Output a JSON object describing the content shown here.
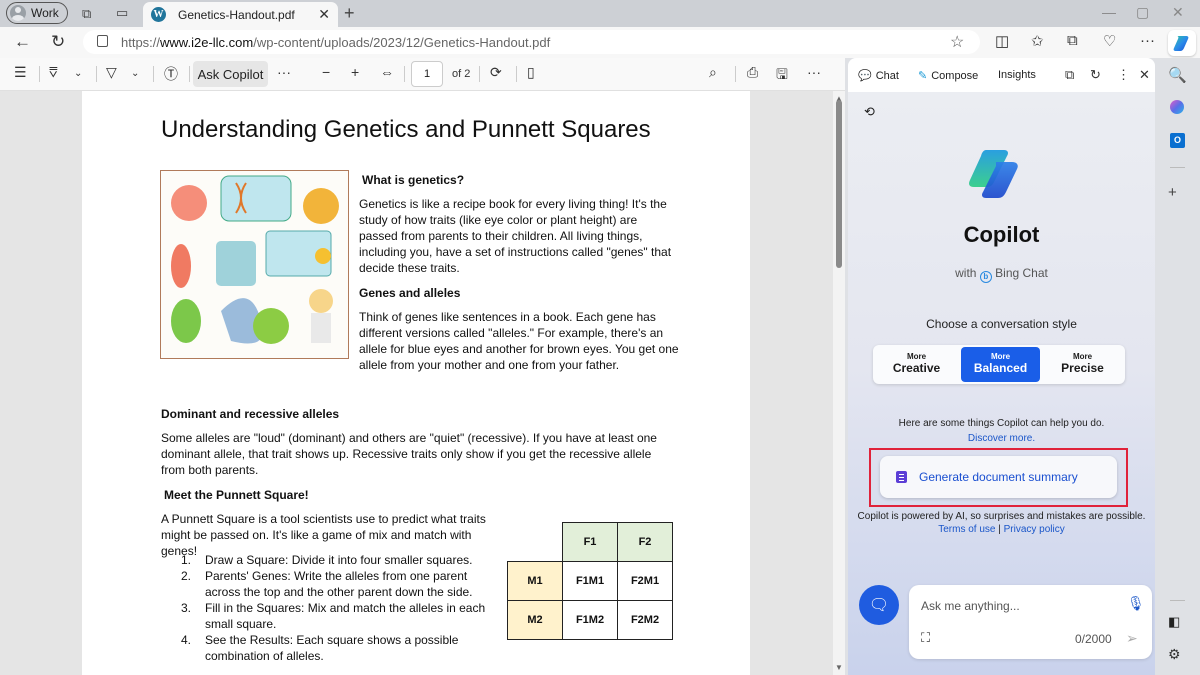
{
  "browser": {
    "profile_label": "Work",
    "tab_title": "Genetics-Handout.pdf",
    "url_prefix": "https://",
    "url_domain": "www.i2e-llc.com",
    "url_path": "/wp-content/uploads/2023/12/Genetics-Handout.pdf"
  },
  "pdf_toolbar": {
    "ask_copilot": "Ask Copilot",
    "page_current": "1",
    "page_total": "of 2",
    "more": "···",
    "zoom_out": "−",
    "zoom_in": "+"
  },
  "document": {
    "title": "Understanding Genetics and Punnett Squares",
    "section1_heading": "What is genetics?",
    "section1_body": "Genetics is like a recipe book for every living thing! It's the study of how traits (like eye color or plant height) are passed from parents to their children. All living things, including you, have a set of instructions called \"genes\" that decide these traits.",
    "section2_heading": "Genes and alleles",
    "section2_body": "Think of genes like sentences in a book. Each gene has different versions called \"alleles.\" For example, there's an allele for blue eyes and another for brown eyes. You get one allele from your mother and one from your father.",
    "section3_heading": "Dominant and recessive alleles",
    "section3_body": "Some alleles are \"loud\" (dominant) and others are \"quiet\" (recessive). If you have at least one dominant allele, that trait shows up. Recessive traits only show if you get the recessive allele from both parents.",
    "section4_heading": "Meet the Punnett Square!",
    "section4_body": "A Punnett Square is a tool scientists use to predict what traits might be passed on. It's like a game of mix and match with genes!",
    "steps": [
      {
        "n": "1.",
        "text": "Draw a Square: Divide it into four smaller squares."
      },
      {
        "n": "2.",
        "text": "Parents' Genes: Write the alleles from one parent across the top and the other parent down the side."
      },
      {
        "n": "3.",
        "text": "Fill in the Squares: Mix and match the alleles in each small square."
      },
      {
        "n": "4.",
        "text": "See the Results: Each square shows a possible combination of alleles."
      }
    ],
    "punnett": {
      "cols": [
        "F1",
        "F2"
      ],
      "rows": [
        {
          "label": "M1",
          "cells": [
            "F1M1",
            "F2M1"
          ]
        },
        {
          "label": "M2",
          "cells": [
            "F1M2",
            "F2M2"
          ]
        }
      ]
    }
  },
  "copilot": {
    "tabs": {
      "chat": "Chat",
      "compose": "Compose",
      "insights": "Insights"
    },
    "title": "Copilot",
    "with": "with",
    "bing_chat": "Bing Chat",
    "choose_style": "Choose a conversation style",
    "styles": [
      {
        "small": "More",
        "label": "Creative",
        "active": false
      },
      {
        "small": "More",
        "label": "Balanced",
        "active": true
      },
      {
        "small": "More",
        "label": "Precise",
        "active": false
      }
    ],
    "help_text": "Here are some things Copilot can help you do.",
    "discover": "Discover more.",
    "suggestion": "Generate document summary",
    "disclaimer": "Copilot is powered by AI, so surprises and mistakes are possible.",
    "terms": "Terms of use",
    "privacy": "Privacy policy",
    "input_placeholder": "Ask me anything...",
    "char_count": "0/2000"
  },
  "colors": {
    "accent": "#1a5ee8",
    "highlight_box": "#e0223a",
    "link": "#1a56c9"
  }
}
